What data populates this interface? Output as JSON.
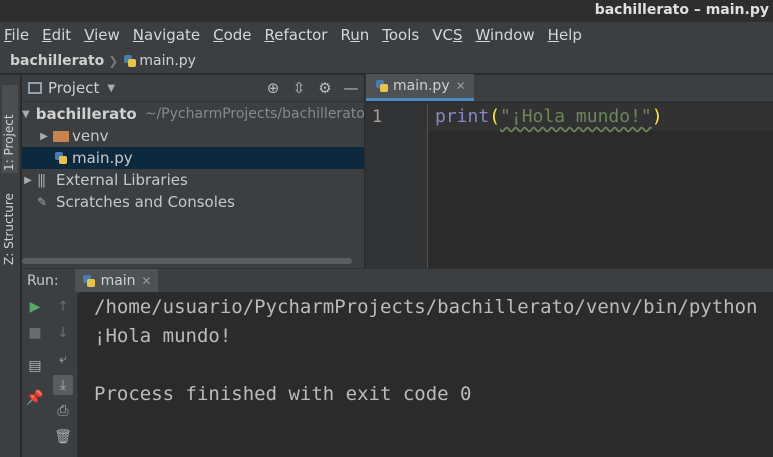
{
  "window": {
    "title": "bachillerato – main.py"
  },
  "menu": [
    {
      "label": "File",
      "key": "F"
    },
    {
      "label": "Edit",
      "key": "E"
    },
    {
      "label": "View",
      "key": "V"
    },
    {
      "label": "Navigate",
      "key": "N"
    },
    {
      "label": "Code",
      "key": "C"
    },
    {
      "label": "Refactor",
      "key": "R"
    },
    {
      "label": "Run",
      "key": "u"
    },
    {
      "label": "Tools",
      "key": "T"
    },
    {
      "label": "VCS",
      "key": "S"
    },
    {
      "label": "Window",
      "key": "W"
    },
    {
      "label": "Help",
      "key": "H"
    }
  ],
  "breadcrumb": {
    "project": "bachillerato",
    "file": "main.py"
  },
  "side_tabs": {
    "project": "1: Project",
    "structure": "Z: Structure"
  },
  "project_panel": {
    "title": "Project",
    "tree": [
      {
        "name": "bachillerato",
        "path": "~/PycharmProjects/bachillerato"
      },
      {
        "name": "venv"
      },
      {
        "name": "main.py"
      },
      {
        "name": "External Libraries"
      },
      {
        "name": "Scratches and Consoles"
      }
    ]
  },
  "editor": {
    "tab": "main.py",
    "line_number": "1",
    "code": {
      "func": "print",
      "open": "(",
      "string": "\"¡Hola mundo!\"",
      "close": ")"
    }
  },
  "run": {
    "label": "Run:",
    "tab": "main",
    "output": [
      "/home/usuario/PycharmProjects/bachillerato/venv/bin/python",
      "¡Hola mundo!",
      "",
      "Process finished with exit code 0"
    ]
  },
  "colors": {
    "background": "#2b2b2b",
    "panel": "#3c3f41",
    "selection": "#0d293e",
    "keyword": "#8888c6",
    "paren": "#ffef28",
    "string": "#6a8759",
    "run_green": "#59a869"
  },
  "icons": {
    "locate": "crosshair-icon",
    "collapse": "collapse-icon",
    "settings": "gear-icon",
    "hide": "minimize-icon",
    "run": "play-icon",
    "stop": "stop-icon"
  }
}
